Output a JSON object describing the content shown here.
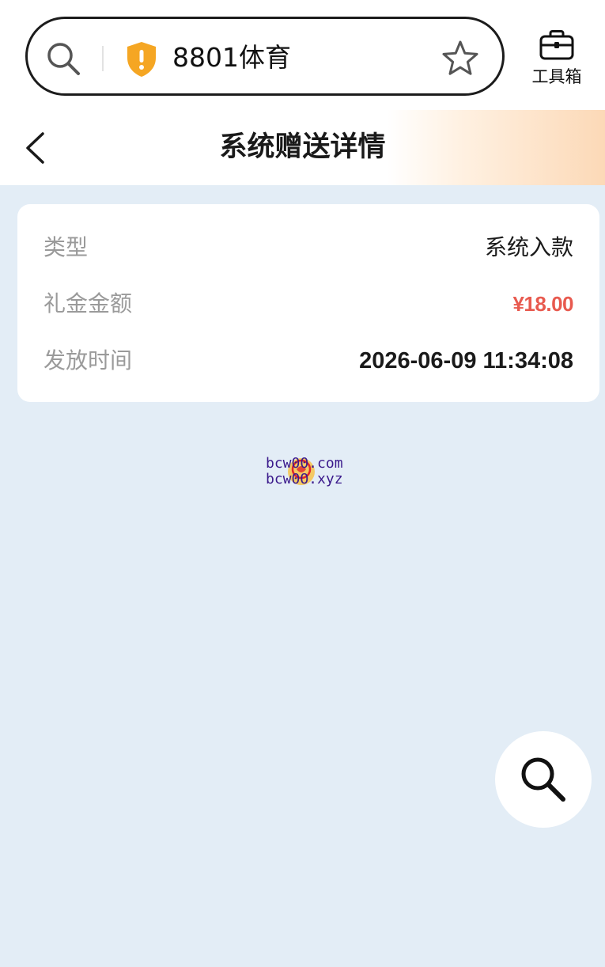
{
  "browser": {
    "url_text": "8801体育",
    "toolbox_label": "工具箱"
  },
  "header": {
    "title": "系统赠送详情"
  },
  "detail": {
    "rows": [
      {
        "label": "类型",
        "value": "系统入款"
      },
      {
        "label": "礼金金额",
        "value": "¥18.00"
      },
      {
        "label": "发放时间",
        "value": "2026-06-09 11:34:08"
      }
    ]
  },
  "watermark": {
    "line1": "bcw00.com",
    "line2": "bcw0O.xyz"
  },
  "icons": {
    "url_search": "search-icon",
    "url_security": "shield-warning-icon",
    "bookmark": "star-icon",
    "toolbox": "toolbox-icon",
    "back": "chevron-left-icon",
    "fab_search": "search-icon"
  },
  "colors": {
    "page_background": "#e3edf6",
    "amount_red": "#e85a4f",
    "shield_orange": "#f5a623",
    "header_gradient_end": "#fcd9b7",
    "label_gray": "#9a9a9a"
  }
}
